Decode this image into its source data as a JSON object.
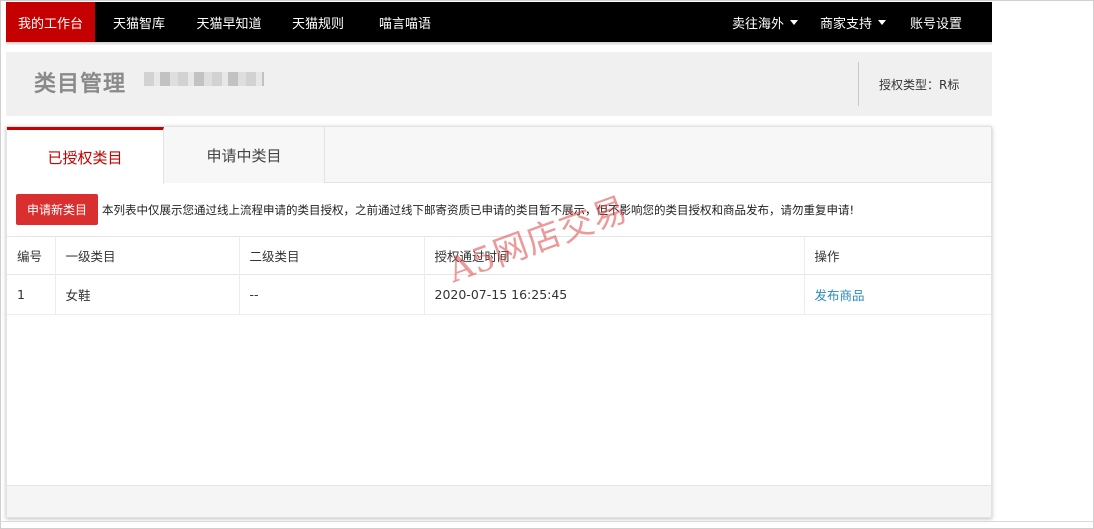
{
  "nav": {
    "left_items": [
      "我的工作台",
      "天猫智库",
      "天猫早知道",
      "天猫规则",
      "喵言喵语"
    ],
    "right_items": [
      {
        "label": "卖往海外",
        "dropdown": true
      },
      {
        "label": "商家支持",
        "dropdown": true
      },
      {
        "label": "账号设置",
        "dropdown": false
      }
    ],
    "active_color": "#c40000"
  },
  "header": {
    "title": "类目管理",
    "auth_type": "授权类型：R标"
  },
  "tabs": [
    {
      "label": "已授权类目",
      "active": true
    },
    {
      "label": "申请中类目",
      "active": false
    }
  ],
  "toolbar": {
    "apply_button": "申请新类目",
    "notice": "本列表中仅展示您通过线上流程申请的类目授权，之前通过线下邮寄资质已申请的类目暂不展示，但不影响您的类目授权和商品发布，请勿重复申请!"
  },
  "table": {
    "headers": [
      "编号",
      "一级类目",
      "二级类目",
      "授权通过时间",
      "操作"
    ],
    "rows": [
      {
        "no": "1",
        "level1": "女鞋",
        "level2": "--",
        "time": "2020-07-15 16:25:45",
        "action": "发布商品"
      }
    ]
  },
  "watermark": "A5网店交易"
}
